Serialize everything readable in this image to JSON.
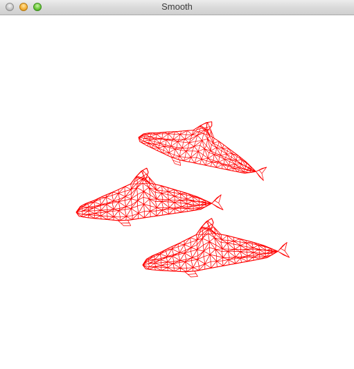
{
  "window": {
    "title": "Smooth"
  },
  "controls": {
    "close_icon": "close-icon",
    "minimize_icon": "minimize-icon",
    "zoom_icon": "zoom-icon"
  },
  "scene": {
    "model": "dolphin",
    "render_mode": "wireframe",
    "count": 3,
    "stroke_color": "#ff0000",
    "background_color": "#ffffff"
  }
}
